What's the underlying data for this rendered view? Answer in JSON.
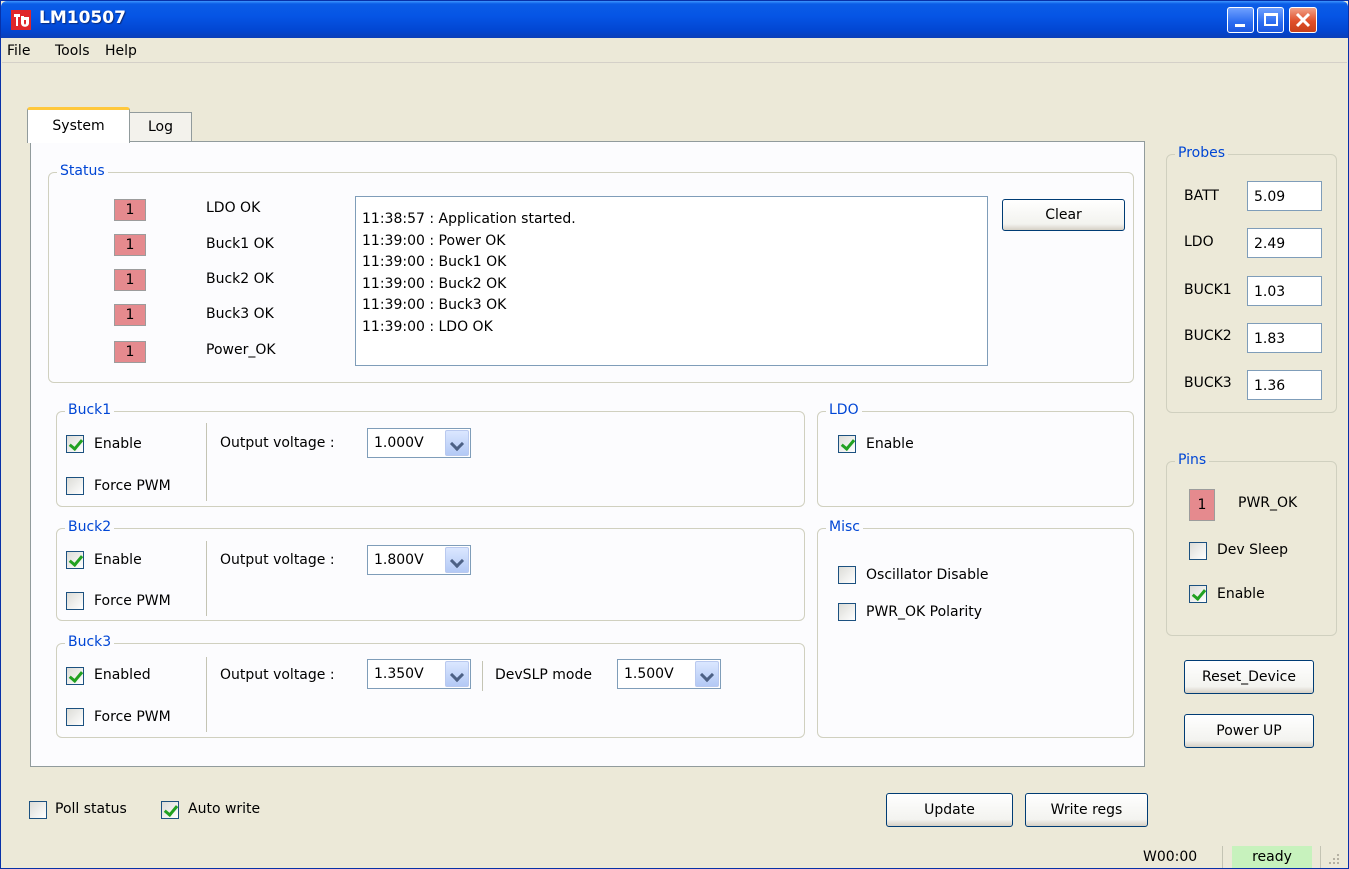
{
  "window": {
    "title": "LM10507"
  },
  "menu": [
    "File",
    "Tools",
    "Help"
  ],
  "tabs": [
    {
      "label": "System"
    },
    {
      "label": "Log"
    }
  ],
  "status": {
    "title": "Status",
    "items": [
      {
        "value": "1",
        "label": "LDO OK"
      },
      {
        "value": "1",
        "label": "Buck1 OK"
      },
      {
        "value": "1",
        "label": "Buck2 OK"
      },
      {
        "value": "1",
        "label": "Buck3 OK"
      },
      {
        "value": "1",
        "label": "Power_OK"
      }
    ],
    "log": [
      "11:38:57 : Application started.",
      "11:39:00 : Power OK",
      "11:39:00 : Buck1 OK",
      "11:39:00 : Buck2 OK",
      "11:39:00 : Buck3 OK",
      "11:39:00 : LDO OK"
    ],
    "clear_label": "Clear"
  },
  "buck1": {
    "title": "Buck1",
    "enable_label": "Enable",
    "enable_checked": true,
    "force_pwm_label": "Force PWM",
    "force_pwm_checked": false,
    "vout_label": "Output voltage :",
    "vout_value": "1.000V"
  },
  "buck2": {
    "title": "Buck2",
    "enable_label": "Enable",
    "enable_checked": true,
    "force_pwm_label": "Force PWM",
    "force_pwm_checked": false,
    "vout_label": "Output voltage :",
    "vout_value": "1.800V"
  },
  "buck3": {
    "title": "Buck3",
    "enable_label": "Enabled",
    "enable_checked": true,
    "force_pwm_label": "Force PWM",
    "force_pwm_checked": false,
    "vout_label": "Output voltage :",
    "vout_value": "1.350V",
    "devslp_label": "DevSLP mode",
    "devslp_value": "1.500V"
  },
  "ldo": {
    "title": "LDO",
    "enable_label": "Enable",
    "enable_checked": true
  },
  "misc": {
    "title": "Misc",
    "osc_disable_label": "Oscillator Disable",
    "osc_disable_checked": false,
    "pwr_ok_polarity_label": "PWR_OK Polarity",
    "pwr_ok_polarity_checked": false
  },
  "probes": {
    "title": "Probes",
    "items": [
      {
        "label": "BATT",
        "value": "5.09"
      },
      {
        "label": "LDO",
        "value": "2.49"
      },
      {
        "label": "BUCK1",
        "value": "1.03"
      },
      {
        "label": "BUCK2",
        "value": "1.83"
      },
      {
        "label": "BUCK3",
        "value": "1.36"
      }
    ]
  },
  "pins": {
    "title": "Pins",
    "pwr_ok_value": "1",
    "pwr_ok_label": "PWR_OK",
    "dev_sleep_label": "Dev Sleep",
    "dev_sleep_checked": false,
    "enable_label": "Enable",
    "enable_checked": true
  },
  "actions": {
    "reset_label": "Reset_Device",
    "power_up_label": "Power UP",
    "update_label": "Update",
    "write_regs_label": "Write regs"
  },
  "bottom": {
    "poll_status_label": "Poll status",
    "poll_status_checked": false,
    "auto_write_label": "Auto write",
    "auto_write_checked": true
  },
  "statusbar": {
    "register": "W00:00",
    "state": "ready"
  },
  "colors": {
    "indicator": "#e58a8e",
    "group_title": "#0046d5",
    "ready": "#c7f2bd"
  }
}
